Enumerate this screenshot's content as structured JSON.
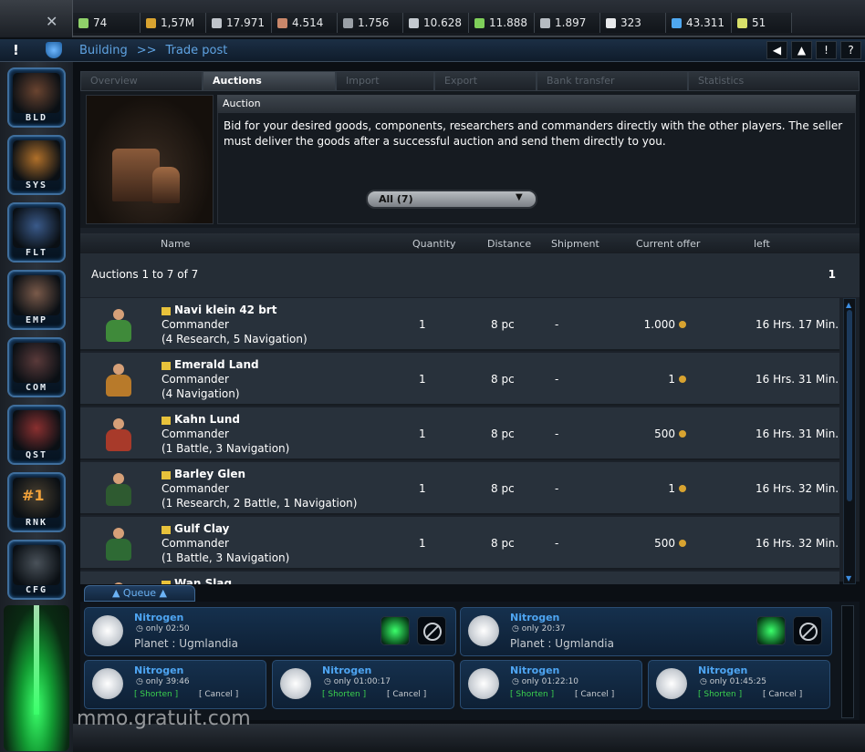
{
  "resources": [
    {
      "icon": "leaf-icon",
      "color": "#8fd16a",
      "value": "74",
      "width": 74
    },
    {
      "icon": "coin-icon",
      "color": "#d8a330",
      "value": "1,57M",
      "width": 72
    },
    {
      "icon": "alloy-icon",
      "color": "#bfc4ca",
      "value": "17.971",
      "width": 72
    },
    {
      "icon": "ore-icon",
      "color": "#c9876a",
      "value": "4.514",
      "width": 72
    },
    {
      "icon": "rock-icon",
      "color": "#9aa0a6",
      "value": "1.756",
      "width": 72
    },
    {
      "icon": "crystal-icon",
      "color": "#c4cad0",
      "value": "10.628",
      "width": 72
    },
    {
      "icon": "plant-icon",
      "color": "#7fcf5a",
      "value": "11.888",
      "width": 72
    },
    {
      "icon": "silicon-icon",
      "color": "#b6bcc2",
      "value": "1.897",
      "width": 72
    },
    {
      "icon": "apple-icon",
      "color": "#e8eaec",
      "value": "323",
      "width": 72
    },
    {
      "icon": "energy-icon",
      "color": "#4fa8f0",
      "value": "43.311",
      "width": 72
    },
    {
      "icon": "population-icon",
      "color": "#d8e06a",
      "value": "51",
      "width": 66
    }
  ],
  "breadcrumb": {
    "first": "Building",
    "sep": ">>",
    "second": "Trade post"
  },
  "nav_buttons": [
    "◀",
    "▲",
    "!",
    "?"
  ],
  "sidebar": [
    {
      "label": "BLD",
      "name": "sidebar-item-building",
      "color": "#6a4430"
    },
    {
      "label": "SYS",
      "name": "sidebar-item-system",
      "color": "#b0702a"
    },
    {
      "label": "FLT",
      "name": "sidebar-item-fleet",
      "color": "#3a5a8a"
    },
    {
      "label": "EMP",
      "name": "sidebar-item-empire",
      "color": "#7a5a4a"
    },
    {
      "label": "COM",
      "name": "sidebar-item-communication",
      "color": "#5a3a3a"
    },
    {
      "label": "QST",
      "name": "sidebar-item-quests",
      "color": "#8a3030"
    },
    {
      "label": "RNK",
      "name": "sidebar-item-ranking",
      "color": "#4a4030",
      "badge": "#1"
    },
    {
      "label": "CFG",
      "name": "sidebar-item-config",
      "color": "#4a525a"
    }
  ],
  "tabs": [
    {
      "label": "Overview",
      "active": false,
      "width": 134
    },
    {
      "label": "Auctions",
      "active": true,
      "width": 146
    },
    {
      "label": "Import",
      "active": false,
      "width": 108
    },
    {
      "label": "Export",
      "active": false,
      "width": 112
    },
    {
      "label": "Bank transfer",
      "active": false,
      "width": 166
    },
    {
      "label": "Statistics",
      "active": false,
      "width": 188
    }
  ],
  "panel_title": "Auction",
  "description": "Bid for your desired goods, components, researchers and commanders directly with the other players. The seller must deliver the goods after a successful auction and send them directly to you.",
  "filter": {
    "value": "All (7)",
    "caret": "▼"
  },
  "columns": {
    "name": "Name",
    "quantity": "Quantity",
    "distance": "Distance",
    "shipment": "Shipment",
    "offer": "Current offer",
    "left": "left"
  },
  "pager": {
    "summary": "Auctions 1 to 7 of 7",
    "page": "1"
  },
  "auctions": [
    {
      "name": "Navi klein 42 brt",
      "type": "Commander",
      "skills": "(4 Research, 5 Navigation)",
      "qty": "1",
      "distance": "8 pc",
      "shipment": "-",
      "offer": "1.000",
      "left": "16 Hrs. 17 Min.",
      "color": "#3f8a3a"
    },
    {
      "name": "Emerald Land",
      "type": "Commander",
      "skills": "(4 Navigation)",
      "qty": "1",
      "distance": "8 pc",
      "shipment": "-",
      "offer": "1",
      "left": "16 Hrs. 31 Min.",
      "color": "#b87a2a"
    },
    {
      "name": "Kahn Lund",
      "type": "Commander",
      "skills": "(1 Battle, 3 Navigation)",
      "qty": "1",
      "distance": "8 pc",
      "shipment": "-",
      "offer": "500",
      "left": "16 Hrs. 31 Min.",
      "color": "#a83a2a"
    },
    {
      "name": "Barley Glen",
      "type": "Commander",
      "skills": "(1 Research, 2 Battle, 1 Navigation)",
      "qty": "1",
      "distance": "8 pc",
      "shipment": "-",
      "offer": "1",
      "left": "16 Hrs. 32 Min.",
      "color": "#2e5a30"
    },
    {
      "name": "Gulf Clay",
      "type": "Commander",
      "skills": "(1 Battle, 3 Navigation)",
      "qty": "1",
      "distance": "8 pc",
      "shipment": "-",
      "offer": "500",
      "left": "16 Hrs. 32 Min.",
      "color": "#2e6a34"
    },
    {
      "name": "Wan Slag",
      "type": "",
      "skills": "",
      "qty": "",
      "distance": "",
      "shipment": "",
      "offer": "",
      "left": "",
      "color": "#3a5a3a"
    }
  ],
  "queue": {
    "tab_label": "▲ Queue ▲",
    "items": [
      {
        "name": "Nitrogen",
        "time": "only 02:50",
        "planet": "Planet : Ugmlandia",
        "big": true
      },
      {
        "name": "Nitrogen",
        "time": "only 20:37",
        "planet": "Planet : Ugmlandia",
        "big": true
      },
      {
        "name": "Nitrogen",
        "time": "only 39:46",
        "shorten": "[ Shorten ]",
        "cancel": "[ Cancel ]",
        "big": false
      },
      {
        "name": "Nitrogen",
        "time": "only 01:00:17",
        "shorten": "[ Shorten ]",
        "cancel": "[ Cancel ]",
        "big": false
      },
      {
        "name": "Nitrogen",
        "time": "only 01:22:10",
        "shorten": "[ Shorten ]",
        "cancel": "[ Cancel ]",
        "big": false
      },
      {
        "name": "Nitrogen",
        "time": "only 01:45:25",
        "shorten": "[ Shorten ]",
        "cancel": "[ Cancel ]",
        "big": false
      }
    ]
  },
  "watermark": "mmo.gratuit.com"
}
